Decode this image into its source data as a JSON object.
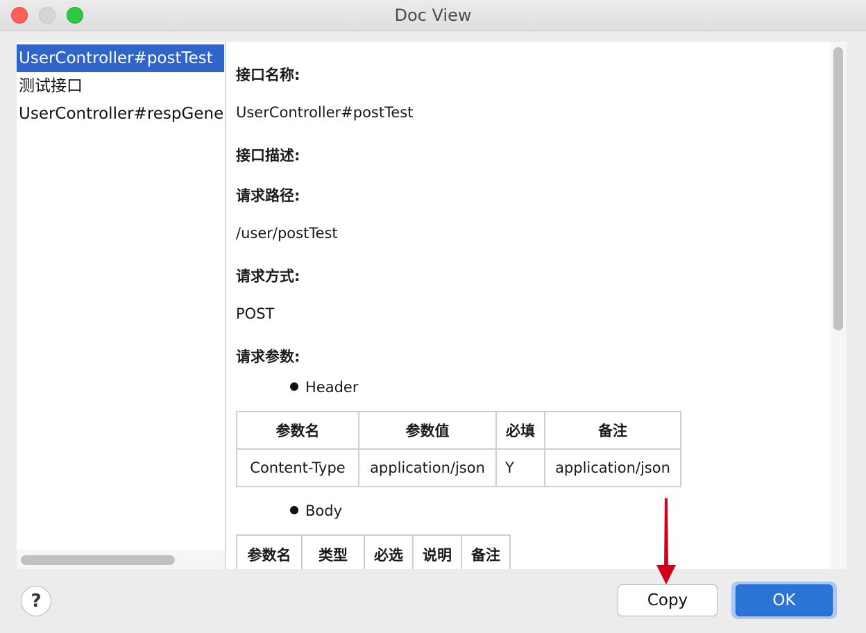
{
  "window": {
    "title": "Doc View"
  },
  "list": {
    "items": [
      {
        "label": "UserController#postTest",
        "selected": true
      },
      {
        "label": "测试接口",
        "selected": false
      },
      {
        "label": "UserController#respGene",
        "selected": false
      }
    ]
  },
  "doc": {
    "name_label": "接口名称:",
    "name_value": "UserController#postTest",
    "desc_label": "接口描述:",
    "path_label": "请求路径:",
    "path_value": "/user/postTest",
    "method_label": "请求方式:",
    "method_value": "POST",
    "params_label": "请求参数:",
    "header_section": "Header",
    "header_table": {
      "columns": [
        "参数名",
        "参数值",
        "必填",
        "备注"
      ],
      "rows": [
        [
          "Content-Type",
          "application/json",
          "Y",
          "application/json"
        ]
      ]
    },
    "body_section": "Body",
    "body_table": {
      "columns": [
        "参数名",
        "类型",
        "必选",
        "说明",
        "备注"
      ]
    }
  },
  "footer": {
    "help_label": "?",
    "copy_label": "Copy",
    "ok_label": "OK"
  },
  "colors": {
    "selection": "#2f65ca",
    "primary_button": "#2b74d6",
    "annotation_arrow": "#d0021b"
  },
  "icons": [
    "help-icon",
    "bullet-icon",
    "annotation-arrow"
  ]
}
